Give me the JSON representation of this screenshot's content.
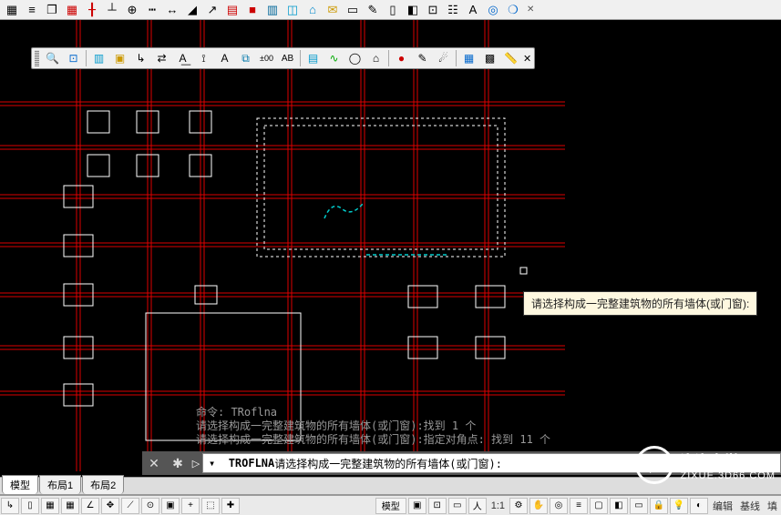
{
  "toolbar_top": {
    "buttons": [
      "layers",
      "copy",
      "stack",
      "grid",
      "axis",
      "line",
      "center",
      "dash",
      "dim-h",
      "dim-a",
      "dim-r",
      "table",
      "red",
      "cols",
      "plan",
      "arch",
      "mail",
      "doc",
      "draw",
      "book",
      "render",
      "wire",
      "items",
      "text-a",
      "globe",
      "info"
    ]
  },
  "toolbar_second": {
    "buttons": [
      "search",
      "zoom",
      "sheet",
      "box",
      "dim-tool",
      "offset",
      "A-measure",
      "A-label",
      "section",
      "plus-minus",
      "AB",
      "table2",
      "wave",
      "circle",
      "house",
      "red-dot",
      "paint",
      "wave2",
      "view",
      "tiles",
      "dots",
      "ruler"
    ]
  },
  "tooltip": "请选择构成一完整建筑物的所有墙体(或门窗):",
  "history": {
    "line1": "命令: TRoflna",
    "line2": "请选择构成一完整建筑物的所有墙体(或门窗):找到 1 个",
    "line3": "请选择构成一完整建筑物的所有墙体(或门窗):指定对角点: 找到 11 个"
  },
  "command": {
    "prefix": "TROFLNA",
    "text": " 请选择构成一完整建筑物的所有墙体(或门窗):"
  },
  "tabs": [
    "模型",
    "布局1",
    "布局2"
  ],
  "statusbar": {
    "left_buttons": [
      "arrow",
      "sheet",
      "grid",
      "grid2",
      "angle",
      "move",
      "curve",
      "dot",
      "tiles",
      "plus",
      "3d",
      "plus2"
    ],
    "model_label": "模型",
    "scale": "1:1",
    "right_labels": [
      "编辑",
      "基线",
      "填"
    ]
  },
  "watermark": {
    "title": "溜溜自学",
    "sub": "ZIXUE.3D66.COM"
  }
}
